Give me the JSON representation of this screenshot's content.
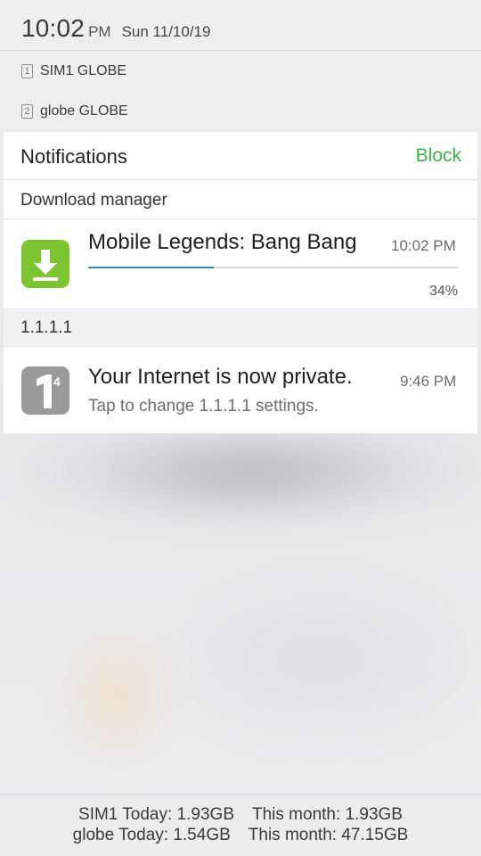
{
  "status": {
    "clock": "10:02",
    "ampm": "PM",
    "date": "Sun 11/10/19"
  },
  "sims": [
    {
      "slot": "1",
      "label": "SIM1 GLOBE"
    },
    {
      "slot": "2",
      "label": "globe GLOBE"
    }
  ],
  "notifications_panel": {
    "title": "Notifications",
    "block_label": "Block"
  },
  "download_manager": {
    "section_label": "Download manager",
    "title": "Mobile Legends: Bang Bang",
    "time": "10:02 PM",
    "progress_text": "34%",
    "progress_fraction": 0.34,
    "icon": "download-icon",
    "accent_color": "#2f8fd6"
  },
  "one_one_one_one": {
    "section_label": "1.1.1.1",
    "title": "Your Internet is now private.",
    "subtitle": "Tap to change 1.1.1.1 settings.",
    "time": "9:46 PM",
    "icon": "one-one-one-one-icon"
  },
  "data_usage": {
    "sim1_today": "SIM1 Today: 1.93GB",
    "sim1_month": "This month: 1.93GB",
    "globe_today": "globe Today: 1.54GB",
    "globe_month": "This month: 47.15GB"
  },
  "colors": {
    "block": "#3cb449",
    "download_icon_bg": "#7dc431"
  }
}
